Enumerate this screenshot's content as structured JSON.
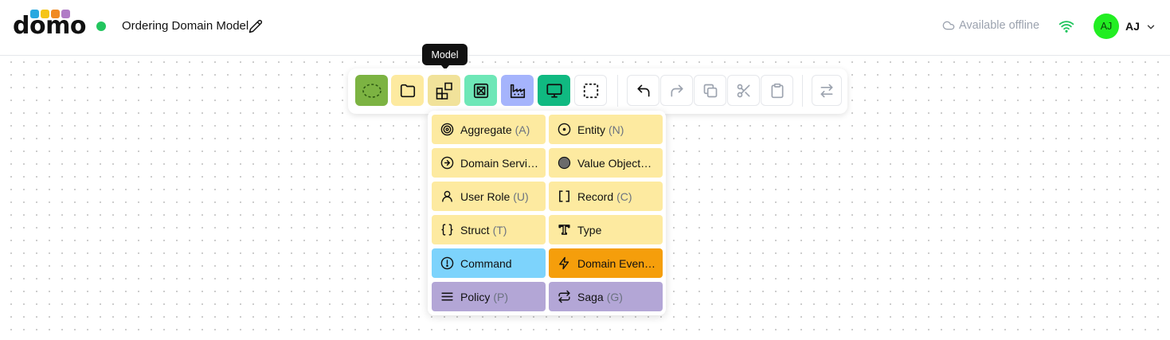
{
  "logo": {
    "word": "domo",
    "dot_colors": [
      "#29a8e0",
      "#f5c518",
      "#f08a24",
      "#b07cc6"
    ]
  },
  "header": {
    "status_color": "#22c55e",
    "document_title": "Ordering Domain Model",
    "offline_label": "Available offline",
    "avatar_initials": "AJ",
    "avatar_color": "#22ee22",
    "user_label": "AJ"
  },
  "toolbar": {
    "tooltip": "Model",
    "buttons": [
      {
        "name": "group-tool",
        "icon": "dashed-ellipse-icon",
        "bg": "#7cb342"
      },
      {
        "name": "folder-tool",
        "icon": "folder-icon",
        "bg": "#fdeaa0"
      },
      {
        "name": "model-tool",
        "icon": "shapes-icon",
        "bg": "#f1e29a"
      },
      {
        "name": "bounded-context-tool",
        "icon": "x-square-icon",
        "bg": "#6ee7b7"
      },
      {
        "name": "factory-tool",
        "icon": "factory-icon",
        "bg": "#a5b4fc"
      },
      {
        "name": "ui-tool",
        "icon": "monitor-icon",
        "bg": "#10b981"
      },
      {
        "name": "select-tool",
        "icon": "dashed-square-icon",
        "bg": "#ffffff"
      },
      {
        "name": "undo",
        "icon": "undo-icon"
      },
      {
        "name": "redo",
        "icon": "redo-icon"
      },
      {
        "name": "copy",
        "icon": "copy-icon"
      },
      {
        "name": "cut",
        "icon": "scissors-icon"
      },
      {
        "name": "paste",
        "icon": "clipboard-icon"
      },
      {
        "name": "swap",
        "icon": "swap-icon"
      }
    ]
  },
  "model_menu": {
    "items": [
      {
        "label": "Aggregate",
        "key": "(A)",
        "icon": "target-icon",
        "color": "#fdeaa0"
      },
      {
        "label": "Entity",
        "key": "(N)",
        "icon": "circle-dot-icon",
        "color": "#fdeaa0"
      },
      {
        "label": "Domain Servi…",
        "key": "",
        "icon": "arrow-circle-icon",
        "color": "#fdeaa0"
      },
      {
        "label": "Value Object…",
        "key": "",
        "icon": "filled-circle-icon",
        "color": "#fdeaa0"
      },
      {
        "label": "User Role",
        "key": "(U)",
        "icon": "user-icon",
        "color": "#fdeaa0"
      },
      {
        "label": "Record",
        "key": "(C)",
        "icon": "brackets-icon",
        "color": "#fdeaa0"
      },
      {
        "label": "Struct",
        "key": "(T)",
        "icon": "braces-icon",
        "color": "#fdeaa0"
      },
      {
        "label": "Type",
        "key": "",
        "icon": "type-icon",
        "color": "#fdeaa0"
      },
      {
        "label": "Command",
        "key": "",
        "icon": "alert-circle-icon",
        "color": "#7dd3fc"
      },
      {
        "label": "Domain Even…",
        "key": "",
        "icon": "zap-icon",
        "color": "#f59e0b"
      },
      {
        "label": "Policy",
        "key": "(P)",
        "icon": "menu-lines-icon",
        "color": "#b3a6d6"
      },
      {
        "label": "Saga",
        "key": "(G)",
        "icon": "repeat-icon",
        "color": "#b3a6d6"
      }
    ]
  }
}
